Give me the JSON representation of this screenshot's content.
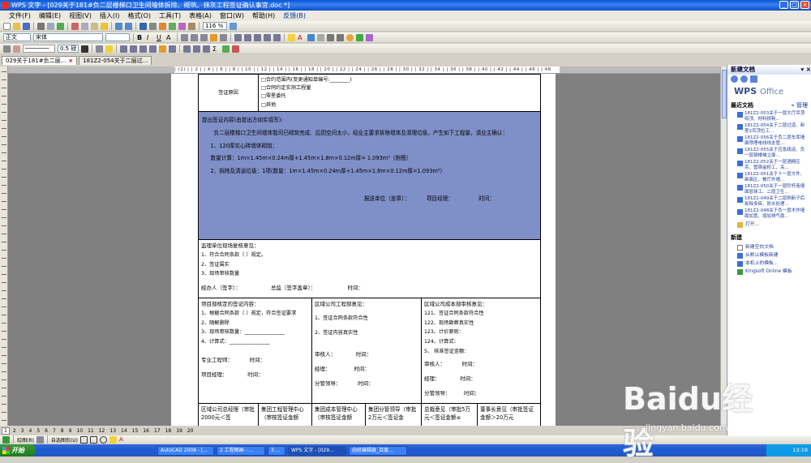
{
  "window": {
    "title": "WPS 文字 - [029关于181#负二层楼梯口卫生间墙体拆除、砌筑、抹灰工程签证确认事宜.doc *]"
  },
  "menu": [
    "文件(F)",
    "编辑(E)",
    "视图(V)",
    "插入(I)",
    "格式(O)",
    "工具(T)",
    "表格(A)",
    "窗口(W)",
    "帮助(H)",
    "反馈(B)"
  ],
  "toolbar": {
    "zoom": "116 %",
    "style": "正文",
    "font": "宋体",
    "line_width": "0.5 磅"
  },
  "tabs": [
    {
      "label": "029关于181#负二层...",
      "active": true
    },
    {
      "label": "181Z2-054关于二层过...",
      "active": false
    }
  ],
  "ruler": {
    "marks": "| (2) | | 2 | | 4 | | 6 | | 8 | | 10 | | 12 | | 14 | | 16 | | 18 | | 20 | | 22 | | 24 | | 26 | | 28 | | 30 | | 32 | | 34 | | 36 | | 38 | | 40 | | 42 | | 44 | | 46 | | 48"
  },
  "doc": {
    "reason_label": "签证原因",
    "reason_items": [
      "□合约范围内(变更通知单编号:________)",
      "□合同约定实测工程量",
      "□零星委托",
      "□其他"
    ],
    "content_title": "提出签证内容(由提出方如实填写):",
    "content_p1": "负二层楼梯口卫生间墙体我司已砌筑完成、后因空间太小，经业主要求拆除墙体及清理垃圾，产生如下工程量，请业主确认：",
    "content_item1": "1、120厚实心砖墙体砌筑：",
    "content_calc1": "数量计算：1m×1.45m×0.24m厚+1.45m×1.8m×0.12m厚= 1.093m³（附图）",
    "content_item2": "2、拆除及清运垃圾：1项(数量：1m×1.45m×0.24m厚+1.45m×1.8m×0.12m厚=1.093m³）",
    "content_sign": "报送单位（盖章）：          项目经理：               时间：",
    "supervision_title": "监理单位现场复核意见：",
    "supervision_items": [
      "1、符合合同条款（    ）规定。",
      "2、签证属实",
      "3、现场审核数量"
    ],
    "supervision_sign": "经办人（签字）：                  总监（签字盖章）：                   时间：",
    "pm_title": "项目部核定的签证内容：",
    "pm_items": [
      "1、根据合同条款（    ）规定，符合签证要求",
      "2、随解删除",
      "3、现场审核数量：________________",
      "4、计算式：________________"
    ],
    "pm_sign1": "专业工程师：          时间：",
    "pm_sign2": "项目经理：            时间：",
    "eng_title": "区域公司工程部意见：",
    "eng_items": [
      "1、签证合同条款符合性",
      "2、签证内容真实性"
    ],
    "eng_sign1": "审核人：            时间：",
    "eng_sign2": "经理：              时间：",
    "eng_sign3": "分管领导：          时间：",
    "cost_title": "区域公司成本部审核意见：",
    "cost_items": [
      "121、签证合同条款符合性",
      "122、现场勘察真实性",
      "123、计价原则：",
      "124、计算式：",
      "5、  核准签证金额："
    ],
    "cost_sign1": "审核人：          时间：",
    "cost_sign2": "经理：            时间：",
    "cost_sign3": "分管领导：        时间：",
    "bottom_cells": [
      "区域公司总经理（审批2000元＜签",
      "集团工程管理中心（审核签证金额",
      "集团成本管理中心（审核签证金额",
      "集团分管领导（审批2万元＜签证金",
      "总裁意见（审批5万元＜签证金额≤",
      "董事长意见（审批签证金额＞20万元"
    ]
  },
  "taskpane": {
    "title": "新建文档",
    "logo": "WPS",
    "logo_sub": "Office",
    "recent_title": "最近文档",
    "recent_manage": "» 管理",
    "recent": [
      "181Z2-053关于一层大厅吊顶吸顶、材料损耗...",
      "181Z2-054关于二层过道、新室2吊顶位工...",
      "181Z2-056关于负二层车库墙面预埋电线线支管...",
      "181Z2-055关于应急疏运、负一层钢楼梯立面...",
      "181Z2-052关于一层酒精区吊、管钢盒柜工、关...",
      "181Z2-051关于十一层文件、画面区、餐厅外墙...",
      "181Z2-050关于一层阶杆造墙面层抹工、二层卫生...",
      "181Z2-049关于二层刷新子后拆除多砖、防水处理...",
      "181Z2-048关于负一层木作墙面加宽、增加排气扇..."
    ],
    "open": "打开...",
    "new_title": "新建",
    "new_items": [
      "新建空白文档",
      "从默认模板新建",
      "本机上的模板...",
      "Kingsoft Online 模板"
    ]
  },
  "statusbar": {
    "page_buttons": [
      "1",
      "2",
      "3",
      "4",
      "5",
      "6",
      "7",
      "8",
      "9",
      "10",
      "11",
      "12",
      "13",
      "14",
      "15",
      "16",
      "17",
      "18",
      "19",
      "20"
    ],
    "draw_label": "绘图(R)",
    "autoshape": "自选图形(U)"
  },
  "taskbar": {
    "start": "开始",
    "buttons": [
      "AutoCAD 2008 - [...",
      "2 工程图画 - ...",
      "3 ...",
      "WPS 文字 - [029...",
      "函经编辑器_百度..."
    ],
    "time": "13:19"
  },
  "watermark": {
    "brand": "Baidu经验",
    "url": "jingyan.baidu.com"
  }
}
